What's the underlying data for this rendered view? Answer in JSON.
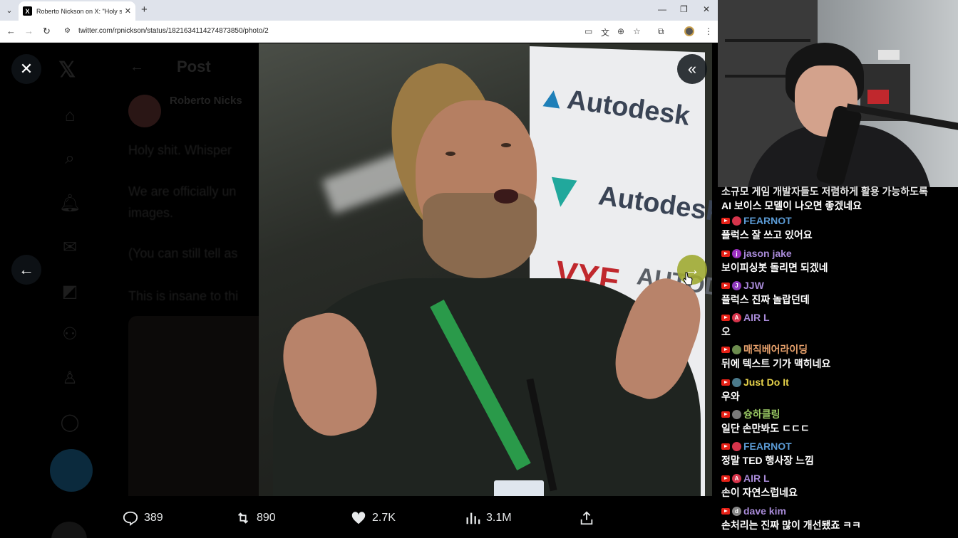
{
  "browser": {
    "tab_title": "Roberto Nickson on X: \"Holy s",
    "tab_favicon": "X",
    "url": "twitter.com/rpnickson/status/1821634114274873850/photo/2"
  },
  "x_page": {
    "post_header": "Post",
    "author_name": "Roberto Nicks",
    "lines": [
      "Holy shit. Whisper",
      "We are officially un",
      "images.",
      "(You can still tell as",
      "This is insane to thi"
    ]
  },
  "actions": {
    "replies": "389",
    "reposts": "890",
    "likes": "2.7K",
    "views": "3.1M"
  },
  "photo_signage": {
    "brand1": "Autodesk",
    "brand2": "Autodesk",
    "brand3": "VYF",
    "brand3_suffix": "AUTODE"
  },
  "chat": {
    "top_line1": "소규모 게임 개발자들도 저렴하게 활용 가능하도록",
    "top_line2": "AI 보이스 모델이 나오면 좋겠네요",
    "messages": [
      {
        "user": "FEARNOT",
        "text": "플럭스 잘 쓰고 있어요",
        "color": "#5b9bd5",
        "avatar": "#d6344b",
        "initial": ""
      },
      {
        "user": "jason jake",
        "text": "보이피싱봇 돌리면 되겠네",
        "color": "#a98bd9",
        "avatar": "#9b2fc0",
        "initial": "j"
      },
      {
        "user": "JJW",
        "text": "플럭스 진짜 놀랍던데",
        "color": "#a98bd9",
        "avatar": "#8e3bbd",
        "initial": "J"
      },
      {
        "user": "AIR L",
        "text": "오",
        "color": "#a98bd9",
        "avatar": "#d6344b",
        "initial": "A"
      },
      {
        "user": "매직베어라이딩",
        "text": "뒤에 텍스트 기가 맥히네요",
        "color": "#e6a06b",
        "avatar": "#6c8c4e",
        "initial": ""
      },
      {
        "user": "Just Do It",
        "text": "우와",
        "color": "#e6d24a",
        "avatar": "#4a7a8c",
        "initial": ""
      },
      {
        "user": "슝하클링",
        "text": "일단 손만봐도 ㄷㄷㄷ",
        "color": "#9ccc65",
        "avatar": "#7a7a7a",
        "initial": ""
      },
      {
        "user": "FEARNOT",
        "text": "정말 TED 행사장 느낌",
        "color": "#5b9bd5",
        "avatar": "#d6344b",
        "initial": ""
      },
      {
        "user": "AIR L",
        "text": "손이 자연스럽네요",
        "color": "#a98bd9",
        "avatar": "#d6344b",
        "initial": "A"
      },
      {
        "user": "dave kim",
        "text": "손처리는 진짜 많이 개선됐죠 ㅋㅋ",
        "color": "#a98bd9",
        "avatar": "#888",
        "initial": "d"
      }
    ]
  }
}
